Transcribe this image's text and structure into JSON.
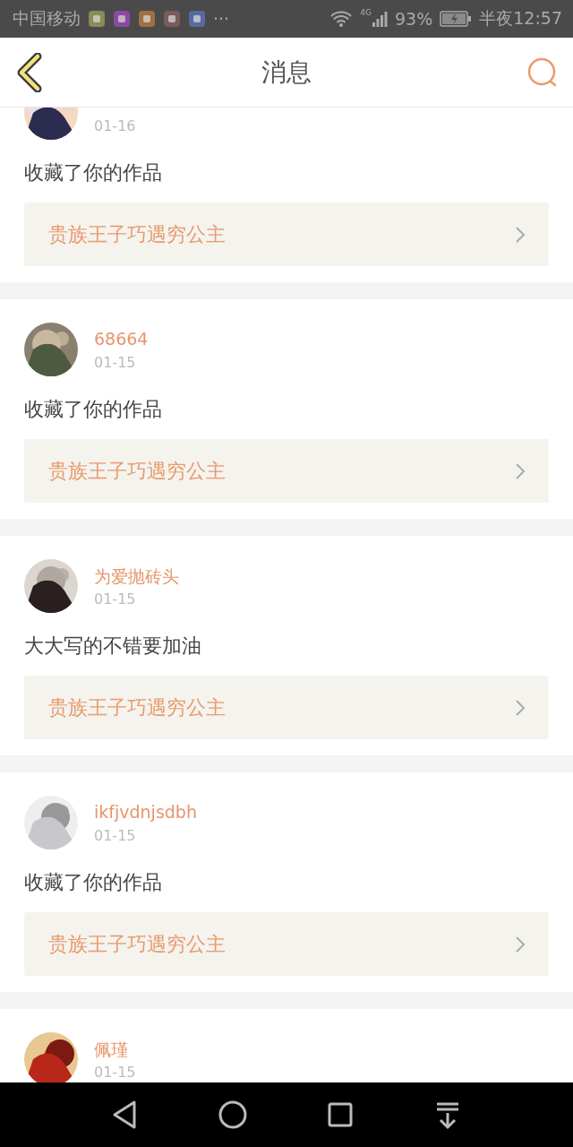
{
  "status_bar": {
    "carrier": "中国移动",
    "more": "···",
    "network": "4G",
    "battery": "93%",
    "time": "半夜12:57"
  },
  "header": {
    "title": "消息"
  },
  "messages": [
    {
      "date": "01-16",
      "message": "收藏了你的作品",
      "work_title": "贵族王子巧遇穷公主"
    },
    {
      "name": "68664",
      "date": "01-15",
      "message": "收藏了你的作品",
      "work_title": "贵族王子巧遇穷公主"
    },
    {
      "name": "为爱抛砖头",
      "date": "01-15",
      "message": "大大写的不错要加油",
      "work_title": "贵族王子巧遇穷公主"
    },
    {
      "name": "ikfjvdnjsdbh",
      "date": "01-15",
      "message": "收藏了你的作品",
      "work_title": "贵族王子巧遇穷公主"
    },
    {
      "name": "佩瑾",
      "date": "01-15"
    }
  ]
}
